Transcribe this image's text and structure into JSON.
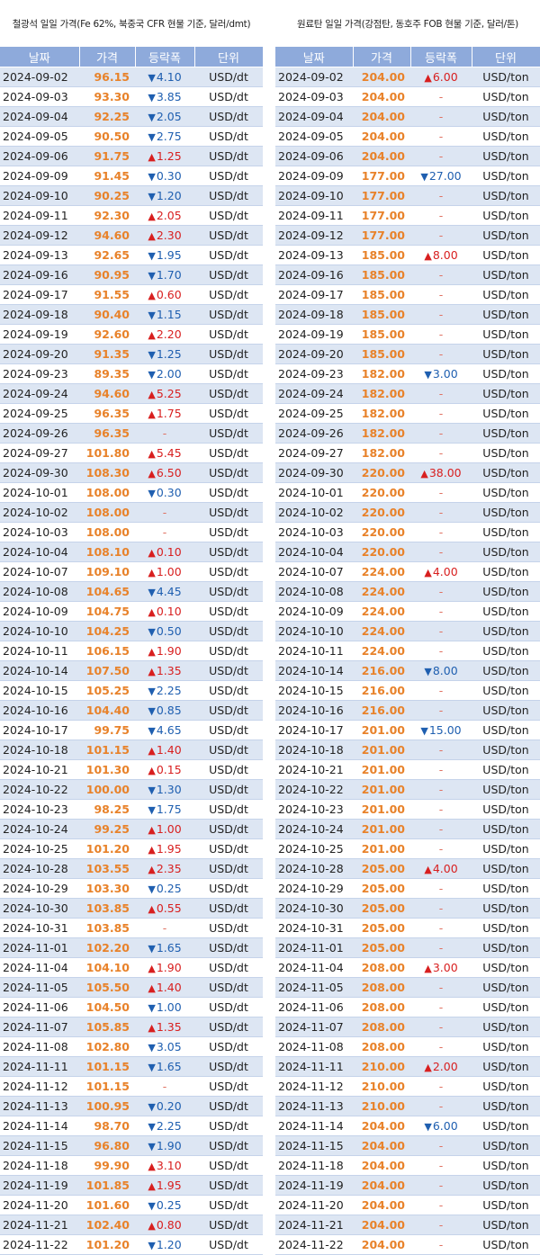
{
  "left": {
    "title": "철광석 일일 가격(Fe 62%, 북중국 CFR 현물 기준, 달러/dmt)",
    "headers": [
      "날짜",
      "가격",
      "등락폭",
      "단위"
    ],
    "rows": [
      [
        "2024-09-02",
        "96.15",
        "down",
        "4.10",
        "USD/dt"
      ],
      [
        "2024-09-03",
        "93.30",
        "down",
        "3.85",
        "USD/dt"
      ],
      [
        "2024-09-04",
        "92.25",
        "down",
        "2.05",
        "USD/dt"
      ],
      [
        "2024-09-05",
        "90.50",
        "down",
        "2.75",
        "USD/dt"
      ],
      [
        "2024-09-06",
        "91.75",
        "up",
        "1.25",
        "USD/dt"
      ],
      [
        "2024-09-09",
        "91.45",
        "down",
        "0.30",
        "USD/dt"
      ],
      [
        "2024-09-10",
        "90.25",
        "down",
        "1.20",
        "USD/dt"
      ],
      [
        "2024-09-11",
        "92.30",
        "up",
        "2.05",
        "USD/dt"
      ],
      [
        "2024-09-12",
        "94.60",
        "up",
        "2.30",
        "USD/dt"
      ],
      [
        "2024-09-13",
        "92.65",
        "down",
        "1.95",
        "USD/dt"
      ],
      [
        "2024-09-16",
        "90.95",
        "down",
        "1.70",
        "USD/dt"
      ],
      [
        "2024-09-17",
        "91.55",
        "up",
        "0.60",
        "USD/dt"
      ],
      [
        "2024-09-18",
        "90.40",
        "down",
        "1.15",
        "USD/dt"
      ],
      [
        "2024-09-19",
        "92.60",
        "up",
        "2.20",
        "USD/dt"
      ],
      [
        "2024-09-20",
        "91.35",
        "down",
        "1.25",
        "USD/dt"
      ],
      [
        "2024-09-23",
        "89.35",
        "down",
        "2.00",
        "USD/dt"
      ],
      [
        "2024-09-24",
        "94.60",
        "up",
        "5.25",
        "USD/dt"
      ],
      [
        "2024-09-25",
        "96.35",
        "up",
        "1.75",
        "USD/dt"
      ],
      [
        "2024-09-26",
        "96.35",
        "flat",
        "-",
        "USD/dt"
      ],
      [
        "2024-09-27",
        "101.80",
        "up",
        "5.45",
        "USD/dt"
      ],
      [
        "2024-09-30",
        "108.30",
        "up",
        "6.50",
        "USD/dt"
      ],
      [
        "2024-10-01",
        "108.00",
        "down",
        "0.30",
        "USD/dt"
      ],
      [
        "2024-10-02",
        "108.00",
        "flat",
        "-",
        "USD/dt"
      ],
      [
        "2024-10-03",
        "108.00",
        "flat",
        "-",
        "USD/dt"
      ],
      [
        "2024-10-04",
        "108.10",
        "up",
        "0.10",
        "USD/dt"
      ],
      [
        "2024-10-07",
        "109.10",
        "up",
        "1.00",
        "USD/dt"
      ],
      [
        "2024-10-08",
        "104.65",
        "down",
        "4.45",
        "USD/dt"
      ],
      [
        "2024-10-09",
        "104.75",
        "up",
        "0.10",
        "USD/dt"
      ],
      [
        "2024-10-10",
        "104.25",
        "down",
        "0.50",
        "USD/dt"
      ],
      [
        "2024-10-11",
        "106.15",
        "up",
        "1.90",
        "USD/dt"
      ],
      [
        "2024-10-14",
        "107.50",
        "up",
        "1.35",
        "USD/dt"
      ],
      [
        "2024-10-15",
        "105.25",
        "down",
        "2.25",
        "USD/dt"
      ],
      [
        "2024-10-16",
        "104.40",
        "down",
        "0.85",
        "USD/dt"
      ],
      [
        "2024-10-17",
        "99.75",
        "down",
        "4.65",
        "USD/dt"
      ],
      [
        "2024-10-18",
        "101.15",
        "up",
        "1.40",
        "USD/dt"
      ],
      [
        "2024-10-21",
        "101.30",
        "up",
        "0.15",
        "USD/dt"
      ],
      [
        "2024-10-22",
        "100.00",
        "down",
        "1.30",
        "USD/dt"
      ],
      [
        "2024-10-23",
        "98.25",
        "down",
        "1.75",
        "USD/dt"
      ],
      [
        "2024-10-24",
        "99.25",
        "up",
        "1.00",
        "USD/dt"
      ],
      [
        "2024-10-25",
        "101.20",
        "up",
        "1.95",
        "USD/dt"
      ],
      [
        "2024-10-28",
        "103.55",
        "up",
        "2.35",
        "USD/dt"
      ],
      [
        "2024-10-29",
        "103.30",
        "down",
        "0.25",
        "USD/dt"
      ],
      [
        "2024-10-30",
        "103.85",
        "up",
        "0.55",
        "USD/dt"
      ],
      [
        "2024-10-31",
        "103.85",
        "flat",
        "-",
        "USD/dt"
      ],
      [
        "2024-11-01",
        "102.20",
        "down",
        "1.65",
        "USD/dt"
      ],
      [
        "2024-11-04",
        "104.10",
        "up",
        "1.90",
        "USD/dt"
      ],
      [
        "2024-11-05",
        "105.50",
        "up",
        "1.40",
        "USD/dt"
      ],
      [
        "2024-11-06",
        "104.50",
        "down",
        "1.00",
        "USD/dt"
      ],
      [
        "2024-11-07",
        "105.85",
        "up",
        "1.35",
        "USD/dt"
      ],
      [
        "2024-11-08",
        "102.80",
        "down",
        "3.05",
        "USD/dt"
      ],
      [
        "2024-11-11",
        "101.15",
        "down",
        "1.65",
        "USD/dt"
      ],
      [
        "2024-11-12",
        "101.15",
        "flat",
        "-",
        "USD/dt"
      ],
      [
        "2024-11-13",
        "100.95",
        "down",
        "0.20",
        "USD/dt"
      ],
      [
        "2024-11-14",
        "98.70",
        "down",
        "2.25",
        "USD/dt"
      ],
      [
        "2024-11-15",
        "96.80",
        "down",
        "1.90",
        "USD/dt"
      ],
      [
        "2024-11-18",
        "99.90",
        "up",
        "3.10",
        "USD/dt"
      ],
      [
        "2024-11-19",
        "101.85",
        "up",
        "1.95",
        "USD/dt"
      ],
      [
        "2024-11-20",
        "101.60",
        "down",
        "0.25",
        "USD/dt"
      ],
      [
        "2024-11-21",
        "102.40",
        "up",
        "0.80",
        "USD/dt"
      ],
      [
        "2024-11-22",
        "101.20",
        "down",
        "1.20",
        "USD/dt"
      ]
    ]
  },
  "right": {
    "title": "원료탄 일일 가격(강점탄, 동호주 FOB 현물 기준, 달러/톤)",
    "headers": [
      "날짜",
      "가격",
      "등락폭",
      "단위"
    ],
    "rows": [
      [
        "2024-09-02",
        "204.00",
        "up",
        "6.00",
        "USD/ton"
      ],
      [
        "2024-09-03",
        "204.00",
        "flat",
        "-",
        "USD/ton"
      ],
      [
        "2024-09-04",
        "204.00",
        "flat",
        "-",
        "USD/ton"
      ],
      [
        "2024-09-05",
        "204.00",
        "flat",
        "-",
        "USD/ton"
      ],
      [
        "2024-09-06",
        "204.00",
        "flat",
        "-",
        "USD/ton"
      ],
      [
        "2024-09-09",
        "177.00",
        "down",
        "27.00",
        "USD/ton"
      ],
      [
        "2024-09-10",
        "177.00",
        "flat",
        "-",
        "USD/ton"
      ],
      [
        "2024-09-11",
        "177.00",
        "flat",
        "-",
        "USD/ton"
      ],
      [
        "2024-09-12",
        "177.00",
        "flat",
        "-",
        "USD/ton"
      ],
      [
        "2024-09-13",
        "185.00",
        "up",
        "8.00",
        "USD/ton"
      ],
      [
        "2024-09-16",
        "185.00",
        "flat",
        "-",
        "USD/ton"
      ],
      [
        "2024-09-17",
        "185.00",
        "flat",
        "-",
        "USD/ton"
      ],
      [
        "2024-09-18",
        "185.00",
        "flat",
        "-",
        "USD/ton"
      ],
      [
        "2024-09-19",
        "185.00",
        "flat",
        "-",
        "USD/ton"
      ],
      [
        "2024-09-20",
        "185.00",
        "flat",
        "-",
        "USD/ton"
      ],
      [
        "2024-09-23",
        "182.00",
        "down",
        "3.00",
        "USD/ton"
      ],
      [
        "2024-09-24",
        "182.00",
        "flat",
        "-",
        "USD/ton"
      ],
      [
        "2024-09-25",
        "182.00",
        "flat",
        "-",
        "USD/ton"
      ],
      [
        "2024-09-26",
        "182.00",
        "flat",
        "-",
        "USD/ton"
      ],
      [
        "2024-09-27",
        "182.00",
        "flat",
        "-",
        "USD/ton"
      ],
      [
        "2024-09-30",
        "220.00",
        "up",
        "38.00",
        "USD/ton"
      ],
      [
        "2024-10-01",
        "220.00",
        "flat",
        "-",
        "USD/ton"
      ],
      [
        "2024-10-02",
        "220.00",
        "flat",
        "-",
        "USD/ton"
      ],
      [
        "2024-10-03",
        "220.00",
        "flat",
        "-",
        "USD/ton"
      ],
      [
        "2024-10-04",
        "220.00",
        "flat",
        "-",
        "USD/ton"
      ],
      [
        "2024-10-07",
        "224.00",
        "up",
        "4.00",
        "USD/ton"
      ],
      [
        "2024-10-08",
        "224.00",
        "flat",
        "-",
        "USD/ton"
      ],
      [
        "2024-10-09",
        "224.00",
        "flat",
        "-",
        "USD/ton"
      ],
      [
        "2024-10-10",
        "224.00",
        "flat",
        "-",
        "USD/ton"
      ],
      [
        "2024-10-11",
        "224.00",
        "flat",
        "-",
        "USD/ton"
      ],
      [
        "2024-10-14",
        "216.00",
        "down",
        "8.00",
        "USD/ton"
      ],
      [
        "2024-10-15",
        "216.00",
        "flat",
        "-",
        "USD/ton"
      ],
      [
        "2024-10-16",
        "216.00",
        "flat",
        "-",
        "USD/ton"
      ],
      [
        "2024-10-17",
        "201.00",
        "down",
        "15.00",
        "USD/ton"
      ],
      [
        "2024-10-18",
        "201.00",
        "flat",
        "-",
        "USD/ton"
      ],
      [
        "2024-10-21",
        "201.00",
        "flat",
        "-",
        "USD/ton"
      ],
      [
        "2024-10-22",
        "201.00",
        "flat",
        "-",
        "USD/ton"
      ],
      [
        "2024-10-23",
        "201.00",
        "flat",
        "-",
        "USD/ton"
      ],
      [
        "2024-10-24",
        "201.00",
        "flat",
        "-",
        "USD/ton"
      ],
      [
        "2024-10-25",
        "201.00",
        "flat",
        "-",
        "USD/ton"
      ],
      [
        "2024-10-28",
        "205.00",
        "up",
        "4.00",
        "USD/ton"
      ],
      [
        "2024-10-29",
        "205.00",
        "flat",
        "-",
        "USD/ton"
      ],
      [
        "2024-10-30",
        "205.00",
        "flat",
        "-",
        "USD/ton"
      ],
      [
        "2024-10-31",
        "205.00",
        "flat",
        "-",
        "USD/ton"
      ],
      [
        "2024-11-01",
        "205.00",
        "flat",
        "-",
        "USD/ton"
      ],
      [
        "2024-11-04",
        "208.00",
        "up",
        "3.00",
        "USD/ton"
      ],
      [
        "2024-11-05",
        "208.00",
        "flat",
        "-",
        "USD/ton"
      ],
      [
        "2024-11-06",
        "208.00",
        "flat",
        "-",
        "USD/ton"
      ],
      [
        "2024-11-07",
        "208.00",
        "flat",
        "-",
        "USD/ton"
      ],
      [
        "2024-11-08",
        "208.00",
        "flat",
        "-",
        "USD/ton"
      ],
      [
        "2024-11-11",
        "210.00",
        "up",
        "2.00",
        "USD/ton"
      ],
      [
        "2024-11-12",
        "210.00",
        "flat",
        "-",
        "USD/ton"
      ],
      [
        "2024-11-13",
        "210.00",
        "flat",
        "-",
        "USD/ton"
      ],
      [
        "2024-11-14",
        "204.00",
        "down",
        "6.00",
        "USD/ton"
      ],
      [
        "2024-11-15",
        "204.00",
        "flat",
        "-",
        "USD/ton"
      ],
      [
        "2024-11-18",
        "204.00",
        "flat",
        "-",
        "USD/ton"
      ],
      [
        "2024-11-19",
        "204.00",
        "flat",
        "-",
        "USD/ton"
      ],
      [
        "2024-11-20",
        "204.00",
        "flat",
        "-",
        "USD/ton"
      ],
      [
        "2024-11-21",
        "204.00",
        "flat",
        "-",
        "USD/ton"
      ],
      [
        "2024-11-22",
        "204.00",
        "flat",
        "-",
        "USD/ton"
      ]
    ]
  },
  "colors": {
    "header_bg": "#8eaadb",
    "row_alt": "#dde6f3",
    "price": "#e8822a",
    "up": "#d81f1f",
    "down": "#1f5fb0"
  },
  "icons": {
    "up": "triangle-up-icon",
    "down": "triangle-down-icon"
  }
}
